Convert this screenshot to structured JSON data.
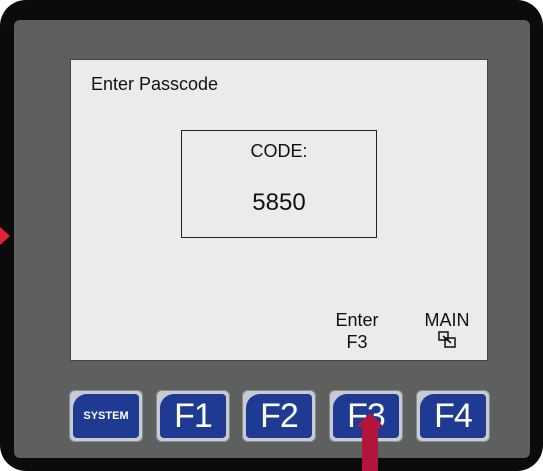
{
  "screen": {
    "title": "Enter Passcode",
    "code_label": "CODE:",
    "code_value": "5850",
    "softkeys": {
      "enter": {
        "line1": "Enter",
        "line2": "F3"
      },
      "main": {
        "label": "MAIN",
        "icon": "main-menu-icon"
      }
    }
  },
  "function_keys": [
    {
      "label": "SYSTEM"
    },
    {
      "label": "F1"
    },
    {
      "label": "F2"
    },
    {
      "label": "F3"
    },
    {
      "label": "F4"
    }
  ],
  "colors": {
    "bezel": "#0b0b0b",
    "panel": "#5d605f",
    "screen": "#ebebeb",
    "key_face": "#1f3a93",
    "indicator_arrow": "#b3143a"
  }
}
